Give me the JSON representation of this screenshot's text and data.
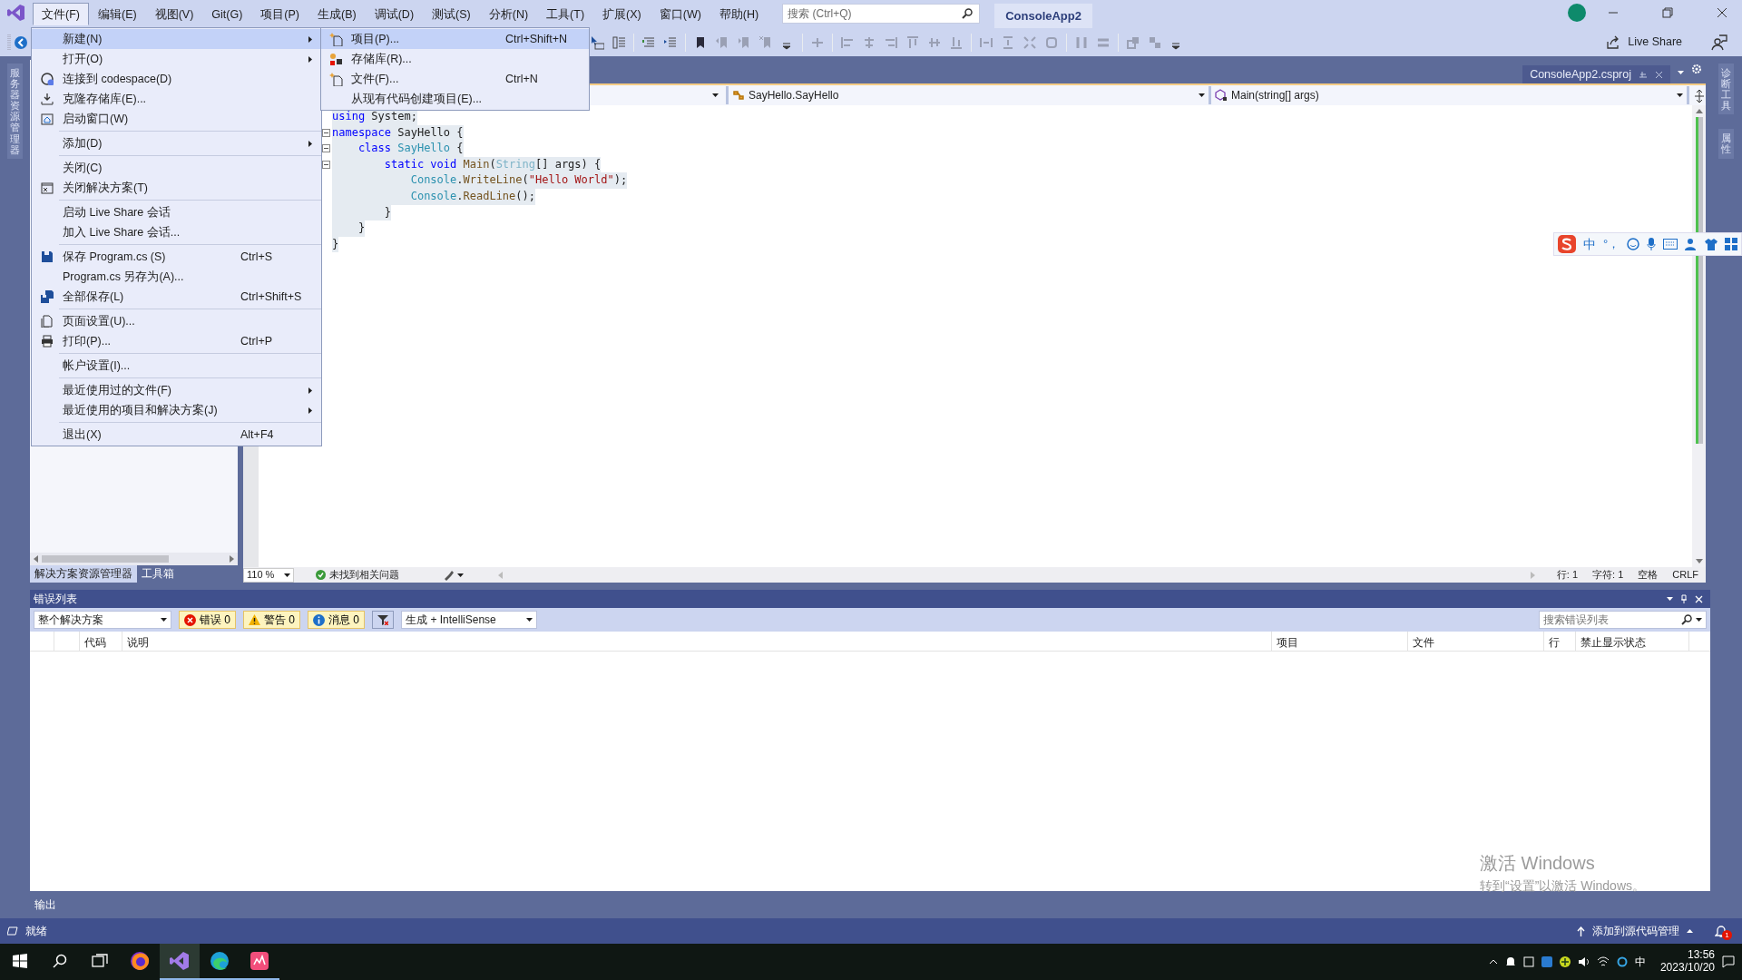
{
  "menu_bar": {
    "items": [
      {
        "label": "文件(F)",
        "selected": true
      },
      {
        "label": "编辑(E)",
        "selected": false
      },
      {
        "label": "视图(V)",
        "selected": false
      },
      {
        "label": "Git(G)",
        "selected": false
      },
      {
        "label": "项目(P)",
        "selected": false
      },
      {
        "label": "生成(B)",
        "selected": false
      },
      {
        "label": "调试(D)",
        "selected": false
      },
      {
        "label": "测试(S)",
        "selected": false
      },
      {
        "label": "分析(N)",
        "selected": false
      },
      {
        "label": "工具(T)",
        "selected": false
      },
      {
        "label": "扩展(X)",
        "selected": false
      },
      {
        "label": "窗口(W)",
        "selected": false
      },
      {
        "label": "帮助(H)",
        "selected": false
      }
    ],
    "search": {
      "placeholder": "搜索 (Ctrl+Q)"
    },
    "solution_name": "ConsoleApp2"
  },
  "toolbar": {
    "live_share": "Live Share"
  },
  "left_tool_strip": {
    "tabs": [
      "服务器资源管理器"
    ]
  },
  "right_tool_strip": {
    "tabs": [
      "诊断工具",
      "属性"
    ]
  },
  "solution_panel": {
    "tabs": [
      {
        "label": "解决方案资源管理器",
        "selected": true
      },
      {
        "label": "工具箱",
        "selected": false
      }
    ]
  },
  "editor": {
    "document_tabs": [
      {
        "label": "ConsoleApp2.csproj",
        "selected": false
      }
    ],
    "navigation": {
      "type": "SayHello.SayHello",
      "member": "Main(string[] args)"
    },
    "code": {
      "selected": true,
      "lines": [
        {
          "foldable": false,
          "tokens": [
            {
              "kind": "keyword",
              "text": "using"
            },
            {
              "kind": "plain",
              "text": " System;"
            }
          ]
        },
        {
          "foldable": true,
          "tokens": [
            {
              "kind": "keyword",
              "text": "namespace"
            },
            {
              "kind": "plain",
              "text": " SayHello {"
            }
          ]
        },
        {
          "foldable": true,
          "tokens": [
            {
              "kind": "keyword",
              "text": "    class "
            },
            {
              "kind": "type",
              "text": "SayHello"
            },
            {
              "kind": "plain",
              "text": " {"
            }
          ]
        },
        {
          "foldable": true,
          "tokens": [
            {
              "kind": "keyword",
              "text": "        static void "
            },
            {
              "kind": "method",
              "text": "Main"
            },
            {
              "kind": "plain",
              "text": "("
            },
            {
              "kind": "faded",
              "text": "String"
            },
            {
              "kind": "plain",
              "text": "[] args) {"
            }
          ]
        },
        {
          "foldable": false,
          "tokens": [
            {
              "kind": "type",
              "text": "            Console"
            },
            {
              "kind": "plain",
              "text": "."
            },
            {
              "kind": "method",
              "text": "WriteLine"
            },
            {
              "kind": "plain",
              "text": "("
            },
            {
              "kind": "string",
              "text": "\"Hello World\""
            },
            {
              "kind": "plain",
              "text": ");"
            }
          ]
        },
        {
          "foldable": false,
          "tokens": [
            {
              "kind": "type",
              "text": "            Console"
            },
            {
              "kind": "plain",
              "text": "."
            },
            {
              "kind": "method",
              "text": "ReadLine"
            },
            {
              "kind": "plain",
              "text": "();"
            }
          ]
        },
        {
          "foldable": false,
          "tokens": [
            {
              "kind": "plain",
              "text": "        }"
            }
          ]
        },
        {
          "foldable": false,
          "tokens": [
            {
              "kind": "plain",
              "text": "    }"
            }
          ]
        },
        {
          "foldable": false,
          "tokens": [
            {
              "kind": "plain",
              "text": "}"
            }
          ]
        }
      ]
    },
    "zoom": "110 %",
    "issues": "未找到相关问题",
    "line": "行: 1",
    "column": "字符: 1",
    "whitespace": "空格",
    "line_ending": "CRLF"
  },
  "file_menu": {
    "items": [
      {
        "kind": "item",
        "label": "新建(N)",
        "submenu": true,
        "selected": true
      },
      {
        "kind": "item",
        "label": "打开(O)",
        "submenu": true,
        "selected": false
      },
      {
        "kind": "item",
        "label": "连接到 codespace(D)",
        "submenu": false,
        "selected": false
      },
      {
        "kind": "item",
        "label": "克隆存储库(E)...",
        "submenu": false,
        "selected": false
      },
      {
        "kind": "item",
        "label": "启动窗口(W)",
        "submenu": false,
        "selected": false
      },
      {
        "kind": "separator"
      },
      {
        "kind": "item",
        "label": "添加(D)",
        "submenu": true,
        "selected": false
      },
      {
        "kind": "separator"
      },
      {
        "kind": "item",
        "label": "关闭(C)",
        "submenu": false,
        "selected": false
      },
      {
        "kind": "item",
        "label": "关闭解决方案(T)",
        "submenu": false,
        "selected": false
      },
      {
        "kind": "separator"
      },
      {
        "kind": "item",
        "label": "启动 Live Share 会话",
        "submenu": false,
        "selected": false
      },
      {
        "kind": "item",
        "label": "加入 Live Share 会话...",
        "submenu": false,
        "selected": false
      },
      {
        "kind": "separator"
      },
      {
        "kind": "item",
        "label": "保存 Program.cs (S)",
        "shortcut": "Ctrl+S",
        "submenu": false,
        "selected": false
      },
      {
        "kind": "item",
        "label": "Program.cs 另存为(A)...",
        "submenu": false,
        "selected": false
      },
      {
        "kind": "item",
        "label": "全部保存(L)",
        "shortcut": "Ctrl+Shift+S",
        "submenu": false,
        "selected": false
      },
      {
        "kind": "separator"
      },
      {
        "kind": "item",
        "label": "页面设置(U)...",
        "submenu": false,
        "selected": false
      },
      {
        "kind": "item",
        "label": "打印(P)...",
        "shortcut": "Ctrl+P",
        "submenu": false,
        "selected": false
      },
      {
        "kind": "separator"
      },
      {
        "kind": "item",
        "label": "帐户设置(I)...",
        "submenu": false,
        "selected": false
      },
      {
        "kind": "separator"
      },
      {
        "kind": "item",
        "label": "最近使用过的文件(F)",
        "submenu": true,
        "selected": false
      },
      {
        "kind": "item",
        "label": "最近使用的项目和解决方案(J)",
        "submenu": true,
        "selected": false
      },
      {
        "kind": "separator"
      },
      {
        "kind": "item",
        "label": "退出(X)",
        "shortcut": "Alt+F4",
        "submenu": false,
        "selected": false
      }
    ]
  },
  "new_submenu": {
    "items": [
      {
        "label": "项目(P)...",
        "shortcut": "Ctrl+Shift+N",
        "selected": true
      },
      {
        "label": "存储库(R)...",
        "selected": false
      },
      {
        "label": "文件(F)...",
        "shortcut": "Ctrl+N",
        "selected": false
      },
      {
        "label": "从现有代码创建项目(E)...",
        "selected": false
      }
    ]
  },
  "error_list": {
    "title": "错误列表",
    "scope": "整个解决方案",
    "filters": [
      {
        "kind": "error",
        "label": "错误 0",
        "selected": true
      },
      {
        "kind": "warning",
        "label": "警告 0",
        "selected": true
      },
      {
        "kind": "message",
        "label": "消息 0",
        "selected": true
      }
    ],
    "source": "生成 + IntelliSense",
    "search": {
      "placeholder": "搜索错误列表"
    },
    "columns": [
      "代码",
      "说明",
      "项目",
      "文件",
      "行",
      "禁止显示状态"
    ]
  },
  "bottom_tabs": [
    {
      "label": "输出",
      "selected": false
    }
  ],
  "status_bar": {
    "state": "就绪",
    "source_control": "添加到源代码管理",
    "notifications": "1"
  },
  "ime_toolbar": {
    "mode": "中",
    "punctuation": "°，"
  },
  "activation_notice": {
    "title": "激活 Windows",
    "hint": "转到“设置”以激活 Windows。"
  },
  "taskbar": {
    "apps": [
      {
        "running": false,
        "active": false
      },
      {
        "running": true,
        "active": true
      },
      {
        "running": true,
        "active": false
      },
      {
        "running": true,
        "active": false
      }
    ],
    "input_mode": "中",
    "time": "13:56",
    "date": "2023/10/20"
  }
}
